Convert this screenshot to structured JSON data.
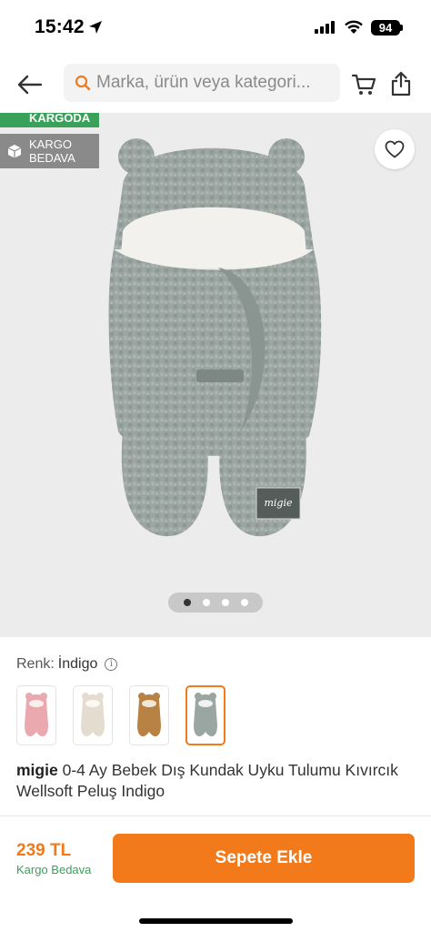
{
  "status_bar": {
    "time": "15:42",
    "battery": "94"
  },
  "header": {
    "search_placeholder": "Marka, ürün veya kategori..."
  },
  "badges": {
    "kargoda": "KARGODA",
    "kargo_bedava_line1": "KARGO",
    "kargo_bedava_line2": "BEDAVA"
  },
  "gallery": {
    "total_images": 4,
    "current_index": 1
  },
  "color_section": {
    "label": "Renk:",
    "selected_value": "İndigo",
    "info_glyph": "i",
    "swatches": [
      {
        "color_name": "pink",
        "hex": "#e9a9ae"
      },
      {
        "color_name": "cream",
        "hex": "#e9e3d6"
      },
      {
        "color_name": "brown",
        "hex": "#b98245"
      },
      {
        "color_name": "indigo",
        "hex": "#9aa6a2",
        "selected": true
      }
    ]
  },
  "product": {
    "brand": "migie",
    "title": "0-4 Ay Bebek Dış Kundak Uyku Tulumu Kıvırcık Wellsoft Peluş Indigo",
    "image_color": "#9ba5a2"
  },
  "bottom_bar": {
    "price": "239 TL",
    "shipping": "Kargo Bedava",
    "add_to_cart": "Sepete Ekle"
  },
  "colors": {
    "accent": "#f27a1a",
    "success": "#3aa15a"
  }
}
